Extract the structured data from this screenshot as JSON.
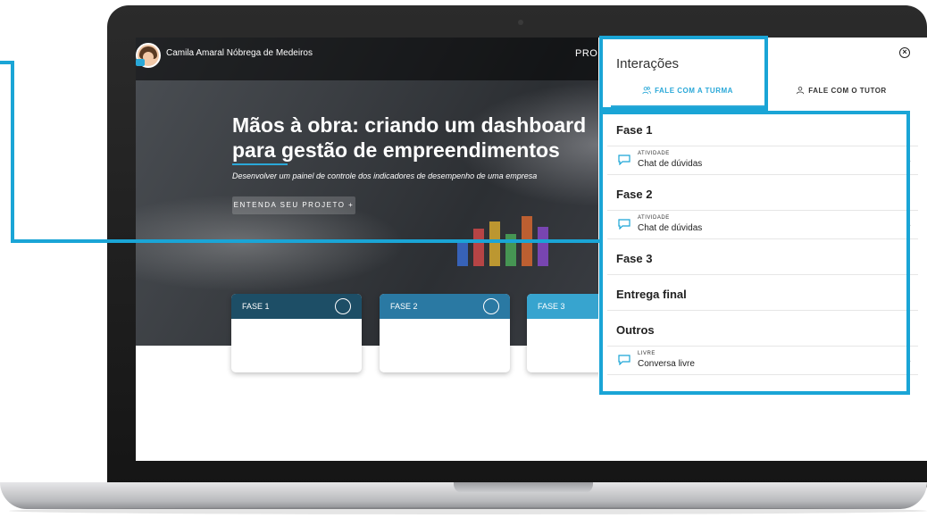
{
  "header": {
    "user_name": "Camila Amaral Nóbrega de Medeiros",
    "nav_partial": "PRO"
  },
  "hero": {
    "title_line1": "Mãos à obra: criando um dashboard",
    "title_line2": "para gestão de empreendimentos",
    "subtitle": "Desenvolver um painel de controle dos indicadores de desempenho de uma empresa",
    "button_label": "ENTENDA SEU PROJETO +"
  },
  "phase_cards": [
    {
      "label": "FASE 1",
      "color": "#1d4e66"
    },
    {
      "label": "FASE 2",
      "color": "#2a79a3"
    },
    {
      "label": "FASE 3",
      "color": "#37a4cf"
    }
  ],
  "panel": {
    "title": "Interações",
    "tabs": [
      {
        "label": "FALE COM A TURMA",
        "active": true
      },
      {
        "label": "FALE COM O TUTOR",
        "active": false
      }
    ],
    "sections": [
      {
        "title": "Fase 1",
        "entries": [
          {
            "kind": "ATIVIDADE",
            "label": "Chat de dúvidas"
          }
        ]
      },
      {
        "title": "Fase 2",
        "entries": [
          {
            "kind": "ATIVIDADE",
            "label": "Chat de dúvidas"
          }
        ]
      },
      {
        "title": "Fase 3",
        "entries": []
      },
      {
        "title": "Entrega final",
        "entries": []
      },
      {
        "title": "Outros",
        "entries": [
          {
            "kind": "LIVRE",
            "label": "Conversa livre"
          }
        ]
      }
    ]
  },
  "colors": {
    "accent": "#1aa5d6",
    "panel_text": "#222222"
  }
}
